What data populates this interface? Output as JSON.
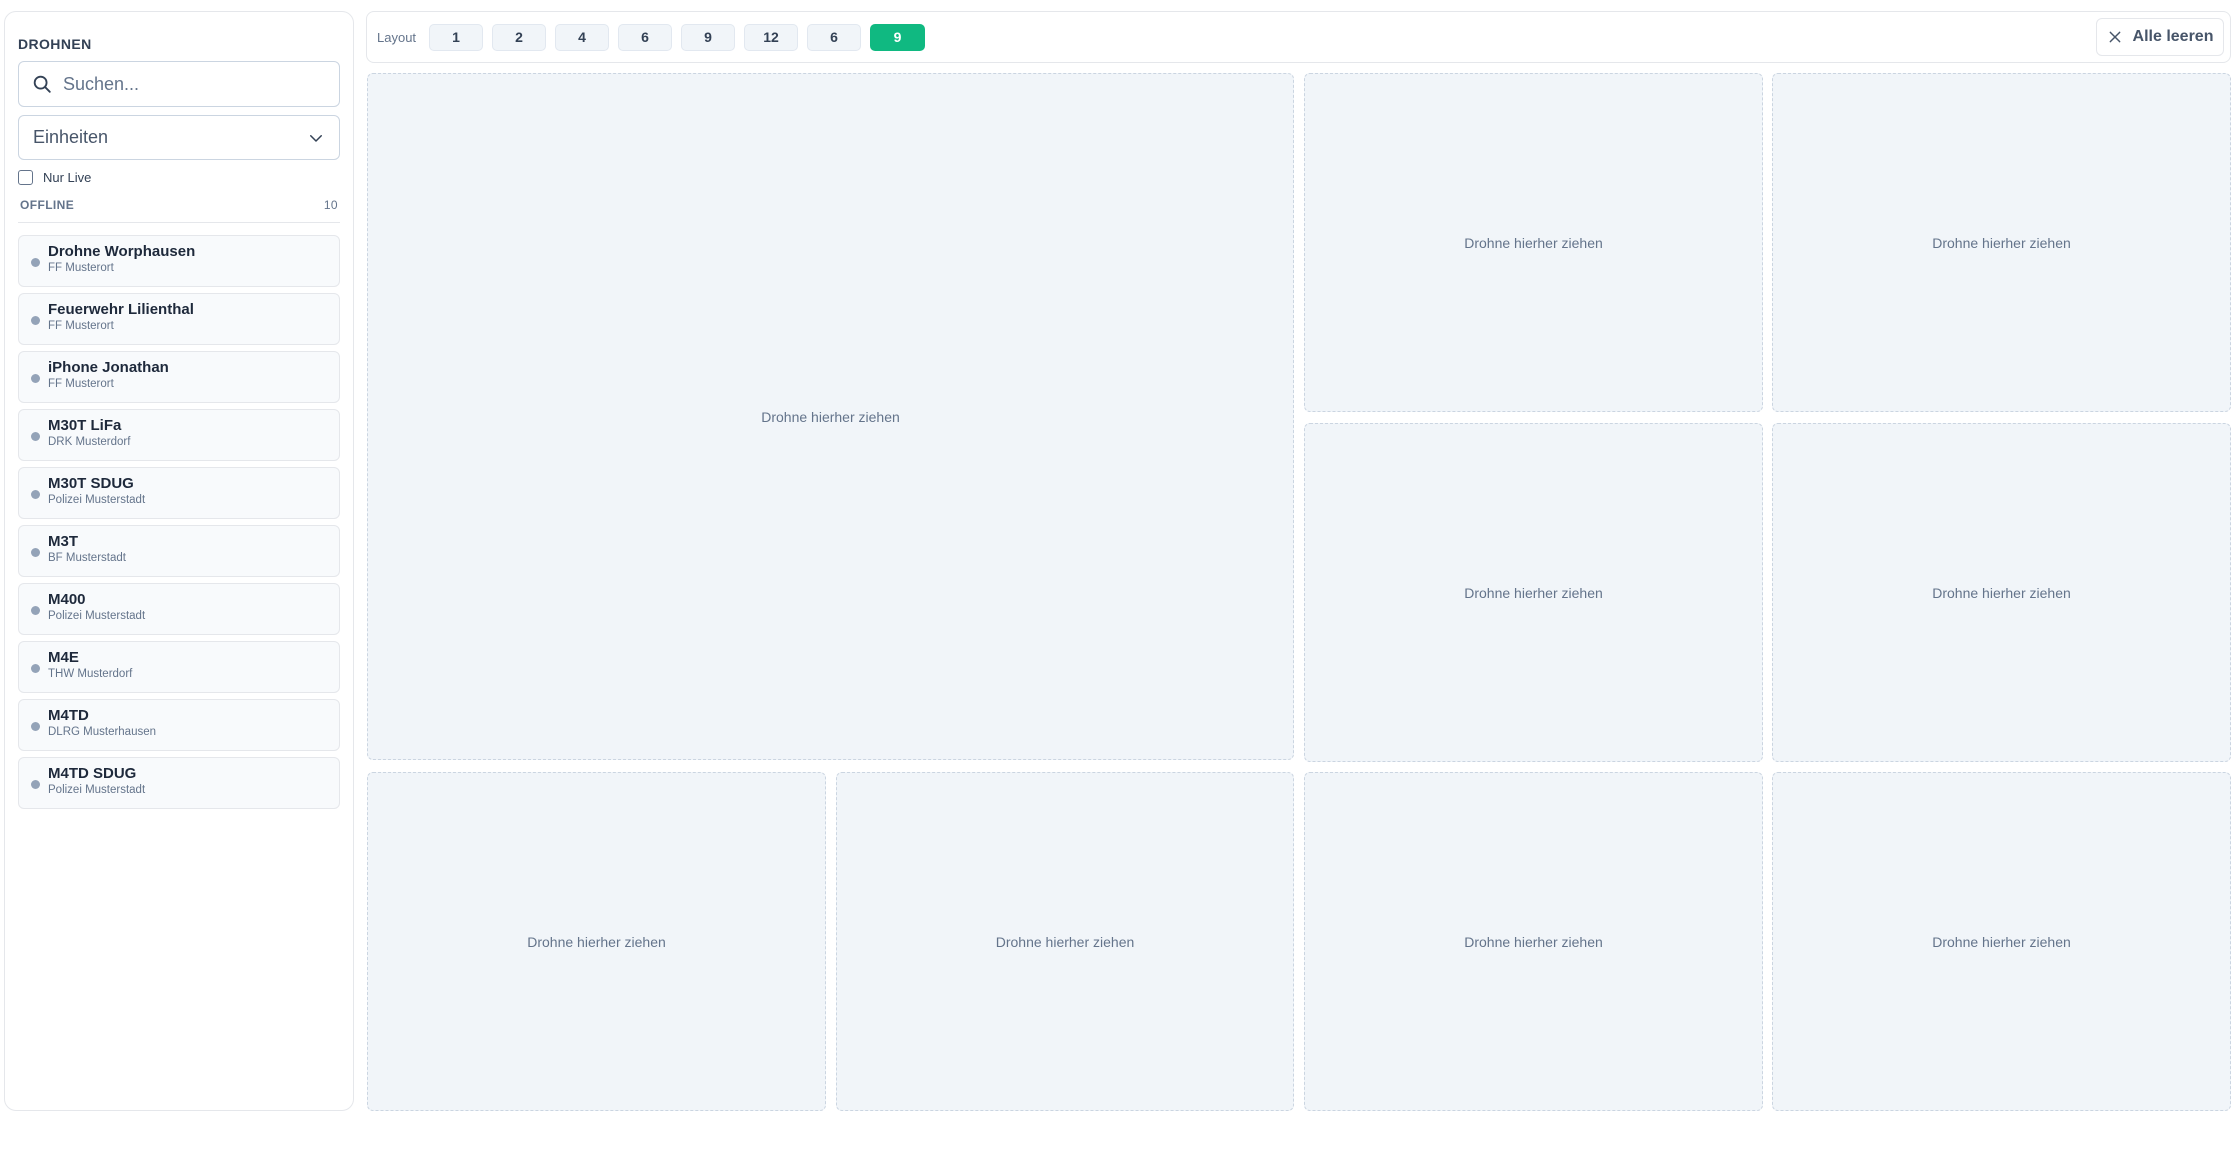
{
  "sidebar": {
    "title": "DROHNEN",
    "search": {
      "placeholder": "Suchen..."
    },
    "units_select": {
      "value": "Einheiten"
    },
    "live_filter": {
      "label": "Nur Live",
      "checked": false
    },
    "group": {
      "label": "OFFLINE",
      "count": "10"
    },
    "drones": [
      {
        "name": "Drohne Worphausen",
        "unit": "FF Musterort",
        "status": "offline"
      },
      {
        "name": "Feuerwehr Lilienthal",
        "unit": "FF Musterort",
        "status": "offline"
      },
      {
        "name": "iPhone Jonathan",
        "unit": "FF Musterort",
        "status": "offline"
      },
      {
        "name": "M30T LiFa",
        "unit": "DRK Musterdorf",
        "status": "offline"
      },
      {
        "name": "M30T SDUG",
        "unit": "Polizei Musterstadt",
        "status": "offline"
      },
      {
        "name": "M3T",
        "unit": "BF Musterstadt",
        "status": "offline"
      },
      {
        "name": "M400",
        "unit": "Polizei Musterstadt",
        "status": "offline"
      },
      {
        "name": "M4E",
        "unit": "THW Musterdorf",
        "status": "offline"
      },
      {
        "name": "M4TD",
        "unit": "DLRG Musterhausen",
        "status": "offline"
      },
      {
        "name": "M4TD SDUG",
        "unit": "Polizei Musterstadt",
        "status": "offline"
      }
    ]
  },
  "toolbar": {
    "layout_label": "Layout",
    "layout_options": [
      "1",
      "2",
      "4",
      "6",
      "9",
      "12",
      "6",
      "9"
    ],
    "active_index": 7,
    "clear_label": "Alle leeren"
  },
  "grid": {
    "placeholder": "Drohne hierher ziehen"
  },
  "colors": {
    "accent": "#10b981",
    "offline_dot": "#94a3b8",
    "cell_bg": "#f1f5f9"
  }
}
